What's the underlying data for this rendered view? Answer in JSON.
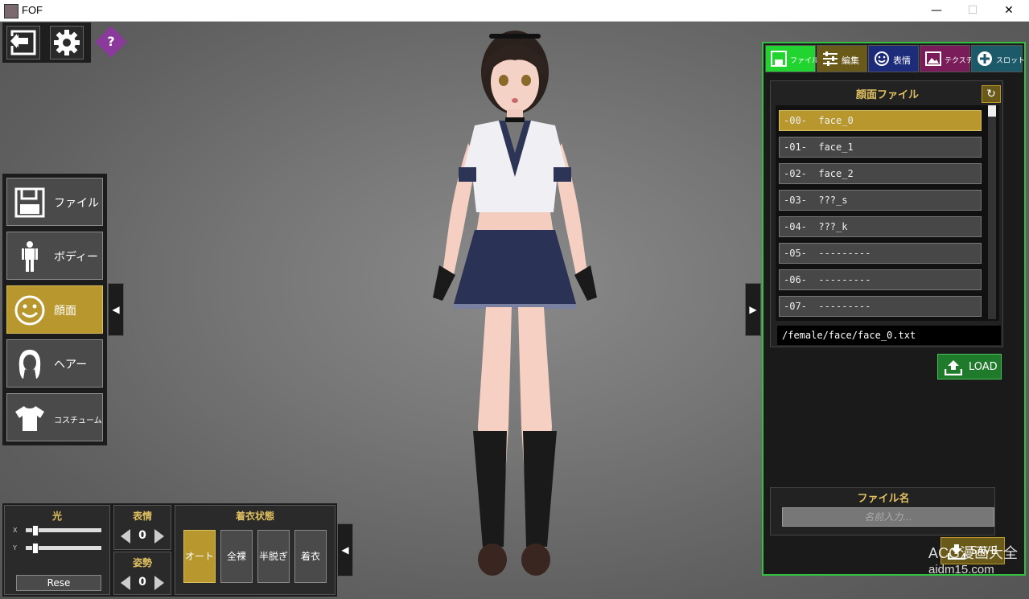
{
  "window": {
    "title": "FOF",
    "minimize": "—",
    "maximize": "☐",
    "close": "✕"
  },
  "top_left": {
    "help_label": "?"
  },
  "left_menu": {
    "items": [
      {
        "label": "ファイル",
        "icon": "floppy-icon"
      },
      {
        "label": "ボディー",
        "icon": "body-icon"
      },
      {
        "label": "顔面",
        "icon": "smiley-icon",
        "active": true
      },
      {
        "label": "ヘアー",
        "icon": "hair-icon"
      },
      {
        "label": "コスチューム",
        "icon": "shirt-icon"
      }
    ],
    "collapse_arrow": "◀"
  },
  "right_panel": {
    "tabs": [
      {
        "label": "ファイル",
        "icon": "floppy-icon",
        "color": "#22d430"
      },
      {
        "label": "編集",
        "icon": "sliders-icon",
        "color": "#6a5a1a"
      },
      {
        "label": "表情",
        "icon": "smiley-icon",
        "color": "#1c2c7a"
      },
      {
        "label": "テクスチャ",
        "icon": "image-icon",
        "color": "#7a1c5a"
      },
      {
        "label": "スロット",
        "icon": "plus-icon",
        "color": "#1c5a6a"
      }
    ],
    "expand_arrow": "▶",
    "file_section_title": "顔面ファイル",
    "refresh_icon": "↻",
    "files": [
      "-00-  face_0",
      "-01-  face_1",
      "-02-  face_2",
      "-03-  ???_s",
      "-04-  ???_k",
      "-05-  ---------",
      "-06-  ---------",
      "-07-  ---------"
    ],
    "selected_index": 0,
    "path": "/female/face/face_0.txt",
    "load_label": "LOAD",
    "filename_title": "ファイル名",
    "filename_placeholder": "名前入力...",
    "save_label": "SAVE"
  },
  "watermark": {
    "line1": "ACG漫画大全",
    "line2": "aidm15.com"
  },
  "bottom_bar": {
    "light_title": "光",
    "x_label": "X",
    "y_label": "Y",
    "reset_label": "Rese",
    "expression_title": "表情",
    "expression_value": "0",
    "pose_title": "姿勢",
    "pose_value": "0",
    "dress_title": "着衣状態",
    "dress_options": [
      "オート",
      "全裸",
      "半脱ぎ",
      "着衣"
    ],
    "dress_selected": 0,
    "collapse_arrow": "◀"
  },
  "colors": {
    "accent_gold": "#b8982e",
    "accent_green": "#32c040",
    "title_yellow": "#e0c060"
  }
}
